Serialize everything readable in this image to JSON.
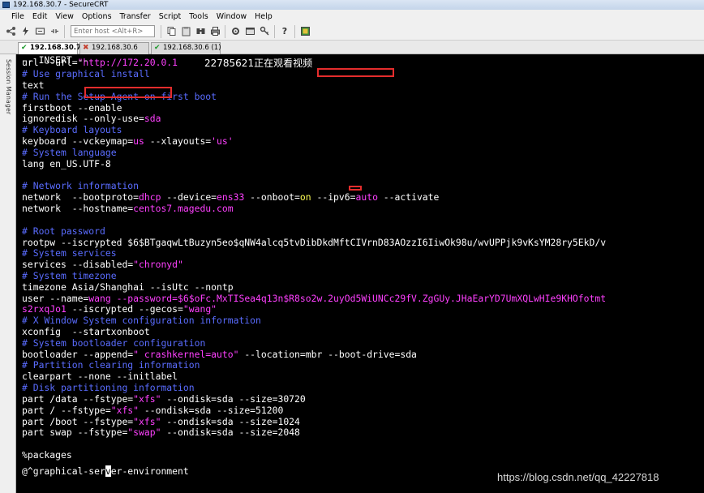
{
  "window": {
    "title": "192.168.30.7 - SecureCRT"
  },
  "menu": [
    "File",
    "Edit",
    "View",
    "Options",
    "Transfer",
    "Script",
    "Tools",
    "Window",
    "Help"
  ],
  "toolbar": {
    "host_placeholder": "Enter host <Alt+R>",
    "icons": [
      "connect-icon",
      "lightning-icon",
      "reconnect-icon",
      "disconnect-icon",
      "copy-icon",
      "paste-icon",
      "find-icon",
      "print-icon",
      "settings-icon",
      "options-icon",
      "key-icon",
      "help-icon",
      "map-icon"
    ]
  },
  "tabs": [
    {
      "label": "192.168.30.7",
      "active": true,
      "status": "connected"
    },
    {
      "label": "192.168.30.6",
      "active": false,
      "status": "disconnected"
    },
    {
      "label": "192.168.30.6 (1)",
      "active": false,
      "status": "connected"
    }
  ],
  "session_panel": {
    "label": "Session Manager"
  },
  "overlay": {
    "text": "22785621正在观看视频"
  },
  "terminal": {
    "lines": [
      [
        [
          "w",
          "url --url="
        ],
        [
          "p",
          "\"http://172.20.0.1"
        ]
      ],
      [
        [
          "c",
          "# Use graphical install"
        ]
      ],
      [
        [
          "w",
          "text"
        ]
      ],
      [
        [
          "c",
          "# Run the Setup Agent on first boot"
        ]
      ],
      [
        [
          "w",
          "firstboot --enable"
        ]
      ],
      [
        [
          "w",
          "ignoredisk --only-use="
        ],
        [
          "p",
          "sda"
        ]
      ],
      [
        [
          "c",
          "# Keyboard layouts"
        ]
      ],
      [
        [
          "w",
          "keyboard --vckeymap="
        ],
        [
          "p",
          "us"
        ],
        [
          "w",
          " --xlayouts="
        ],
        [
          "p",
          "'us'"
        ]
      ],
      [
        [
          "c",
          "# System language"
        ]
      ],
      [
        [
          "w",
          "lang en_US.UTF-8"
        ]
      ],
      [
        [
          "w",
          ""
        ]
      ],
      [
        [
          "c",
          "# Network information"
        ]
      ],
      [
        [
          "w",
          "network  --bootproto="
        ],
        [
          "p",
          "dhcp"
        ],
        [
          "w",
          " --device="
        ],
        [
          "p",
          "ens33"
        ],
        [
          "w",
          " --onboot="
        ],
        [
          "y",
          "on"
        ],
        [
          "w",
          " --ipv6="
        ],
        [
          "p",
          "auto"
        ],
        [
          "w",
          " --activate"
        ]
      ],
      [
        [
          "w",
          "network  --hostname="
        ],
        [
          "p",
          "centos7.magedu.com"
        ]
      ],
      [
        [
          "w",
          ""
        ]
      ],
      [
        [
          "c",
          "# Root password"
        ]
      ],
      [
        [
          "w",
          "rootpw --iscrypted $6$BTgaqwLtBuzyn5eo$qNW4alcq5tvDibDkdMftCIVrnD83AOzzI6IiwOk98u/wvUPPjk9vKsYM28ry5EkD/v"
        ]
      ],
      [
        [
          "c",
          "# System services"
        ]
      ],
      [
        [
          "w",
          "services --disabled="
        ],
        [
          "p",
          "\"chronyd\""
        ]
      ],
      [
        [
          "c",
          "# System timezone"
        ]
      ],
      [
        [
          "w",
          "timezone Asia/Shanghai --isUtc --nontp"
        ]
      ],
      [
        [
          "w",
          "user --name="
        ],
        [
          "p",
          "wang --password=$6$oFc.MxTISea4q13n$R8so2w.2uyOd5WiUNCc29fV.ZgGUy.JHaEarYD7UmXQLwHIe9KHOfotmt"
        ]
      ],
      [
        [
          "p",
          "s2rxqJo1"
        ],
        [
          "w",
          " --iscrypted --gecos="
        ],
        [
          "p",
          "\"wang\""
        ]
      ],
      [
        [
          "c",
          "# X Window System configuration information"
        ]
      ],
      [
        [
          "w",
          "xconfig  --startxonboot"
        ]
      ],
      [
        [
          "c",
          "# System bootloader configuration"
        ]
      ],
      [
        [
          "w",
          "bootloader --append="
        ],
        [
          "p",
          "\" crashkernel=auto\""
        ],
        [
          "w",
          " --location=mbr --boot-drive=sda"
        ]
      ],
      [
        [
          "c",
          "# Partition clearing information"
        ]
      ],
      [
        [
          "w",
          "clearpart --none --initlabel"
        ]
      ],
      [
        [
          "c",
          "# Disk partitioning information"
        ]
      ],
      [
        [
          "w",
          "part /data --fstype="
        ],
        [
          "p",
          "\"xfs\""
        ],
        [
          "w",
          " --ondisk=sda --size=30720"
        ]
      ],
      [
        [
          "w",
          "part / --fstype="
        ],
        [
          "p",
          "\"xfs\""
        ],
        [
          "w",
          " --ondisk=sda --size=51200"
        ]
      ],
      [
        [
          "w",
          "part /boot --fstype="
        ],
        [
          "p",
          "\"xfs\""
        ],
        [
          "w",
          " --ondisk=sda --size=1024"
        ]
      ],
      [
        [
          "w",
          "part swap --fstype="
        ],
        [
          "p",
          "\"swap\""
        ],
        [
          "w",
          " --ondisk=sda --size=2048"
        ]
      ],
      [
        [
          "w",
          ""
        ]
      ],
      [
        [
          "w",
          "%packages"
        ]
      ],
      [
        [
          "w",
          "@^graphical-ser"
        ],
        [
          "k",
          "v"
        ],
        [
          "w",
          "er-environment"
        ]
      ],
      [
        [
          "w",
          "-- INSERT --"
        ]
      ]
    ]
  },
  "watermark": "https://blog.csdn.net/qq_42227818"
}
